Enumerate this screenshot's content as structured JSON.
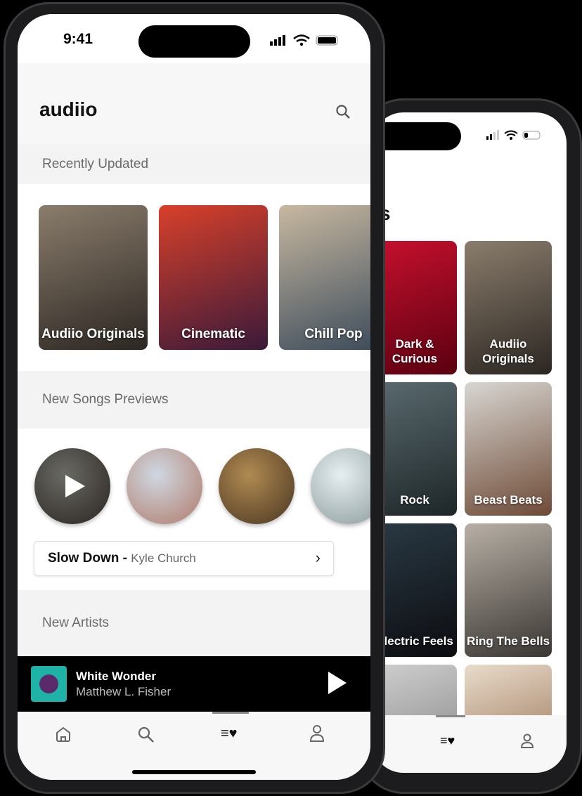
{
  "back_phone": {
    "title_fragment": "s",
    "genres": [
      {
        "label": "Dark & Curious",
        "colors": [
          "#c8102e",
          "#5a0010"
        ]
      },
      {
        "label": "Audiio Originals",
        "colors": [
          "#8a7d6c",
          "#2c2622"
        ]
      },
      {
        "label": "Rock",
        "colors": [
          "#5b6b70",
          "#1d2628"
        ]
      },
      {
        "label": "Beast Beats",
        "colors": [
          "#d8d6d2",
          "#6e4a36"
        ]
      },
      {
        "label": "Electric Feels",
        "colors": [
          "#2a3a44",
          "#0c0c10"
        ]
      },
      {
        "label": "Ring The Bells",
        "colors": [
          "#b8b0a6",
          "#3a3632"
        ]
      },
      {
        "label": "",
        "colors": [
          "#d0d0d0",
          "#777"
        ]
      },
      {
        "label": "",
        "colors": [
          "#e8dccb",
          "#8a5a3a"
        ]
      }
    ],
    "tabs": [
      "playlist-heart-icon",
      "user-icon"
    ]
  },
  "front_phone": {
    "status": {
      "time": "9:41"
    },
    "app_title": "audiio",
    "sections": {
      "recently_updated": "Recently Updated",
      "new_songs": "New Songs Previews",
      "new_artists": "New Artists"
    },
    "recent_cards": [
      {
        "label": "Audiio Originals",
        "colors": [
          "#8a7d6c",
          "#2c2622"
        ]
      },
      {
        "label": "Cinematic",
        "colors": [
          "#d8402a",
          "#3a1a3a"
        ]
      },
      {
        "label": "Chill Pop",
        "colors": [
          "#c8b8a0",
          "#3a4a5a"
        ]
      }
    ],
    "song_previews": [
      {
        "colors": [
          "#6a6a64",
          "#2a2420"
        ],
        "playing": true
      },
      {
        "colors": [
          "#cfd8e2",
          "#b07a6a"
        ]
      },
      {
        "colors": [
          "#b08a52",
          "#4a3620"
        ]
      },
      {
        "colors": [
          "#e6eef2",
          "#8a9a9a"
        ]
      }
    ],
    "selected_song": {
      "title": "Slow Down",
      "separator": " - ",
      "artist": "Kyle Church"
    },
    "now_playing": {
      "title": "White Wonder",
      "artist": "Matthew L. Fisher",
      "art_color": "#1fb3a8"
    },
    "tabs": [
      {
        "icon": "home-icon",
        "active": false
      },
      {
        "icon": "search-icon",
        "active": false
      },
      {
        "icon": "playlist-heart-icon",
        "active": true
      },
      {
        "icon": "user-icon",
        "active": false
      }
    ]
  }
}
